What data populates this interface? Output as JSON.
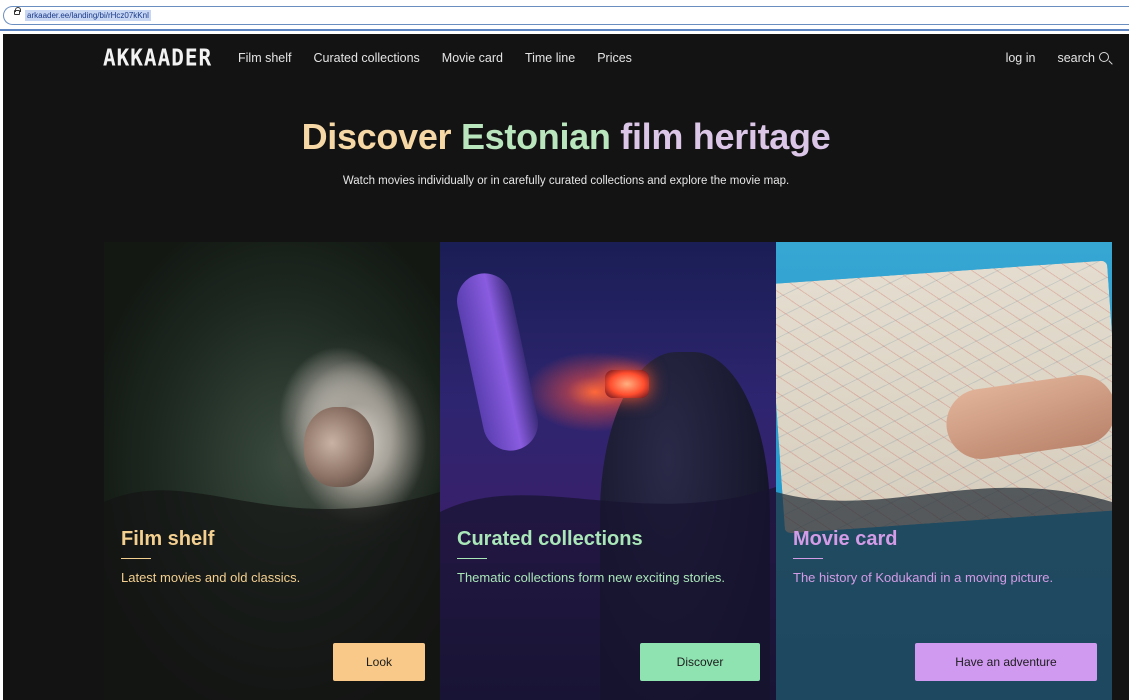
{
  "browser": {
    "url": "arkaader.ee/landing/bi/rHcz07kKnl"
  },
  "nav": {
    "logo": "AKKAADER",
    "links": [
      "Film shelf",
      "Curated collections",
      "Movie card",
      "Time line",
      "Prices"
    ],
    "login": "log in",
    "search": "search",
    "search_icon": "search-icon"
  },
  "hero": {
    "title_part1": "Discover",
    "title_part2": "Estonian",
    "title_part3": "film heritage",
    "subtitle": "Watch movies individually or in carefully curated collections and explore the movie map."
  },
  "cards": [
    {
      "title": "Film shelf",
      "desc": "Latest movies and old classics.",
      "button": "Look",
      "accent": "#f3cf90"
    },
    {
      "title": "Curated collections",
      "desc": "Thematic collections form new exciting stories.",
      "button": "Discover",
      "accent": "#a9e6b8"
    },
    {
      "title": "Movie card",
      "desc": "The history of Kodukandi in a moving picture.",
      "button": "Have an adventure",
      "accent": "#d49ce6"
    }
  ],
  "colors": {
    "background": "#131313",
    "title_orange": "#f6d7a6",
    "title_green": "#b9e6bd",
    "title_purple": "#dcc6e8"
  }
}
